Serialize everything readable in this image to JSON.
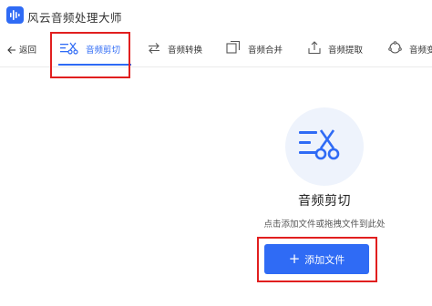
{
  "app": {
    "title": "风云音频处理大师"
  },
  "toolbar": {
    "back_label": "返回",
    "items": [
      {
        "label": "音频剪切",
        "icon": "audio-cut-icon",
        "active": true
      },
      {
        "label": "音频转换",
        "icon": "convert-icon",
        "active": false
      },
      {
        "label": "音频合并",
        "icon": "merge-icon",
        "active": false
      },
      {
        "label": "音频提取",
        "icon": "extract-icon",
        "active": false
      },
      {
        "label": "音频变",
        "icon": "voice-change-icon",
        "active": false
      }
    ]
  },
  "main": {
    "title": "音频剪切",
    "hint": "点击添加文件或拖拽文件到此处",
    "add_button": {
      "plus": "+",
      "label": "添加文件"
    }
  },
  "colors": {
    "accent": "#2f6bf5",
    "highlight": "#e11f1f",
    "hero_bg": "#eef3fc"
  }
}
